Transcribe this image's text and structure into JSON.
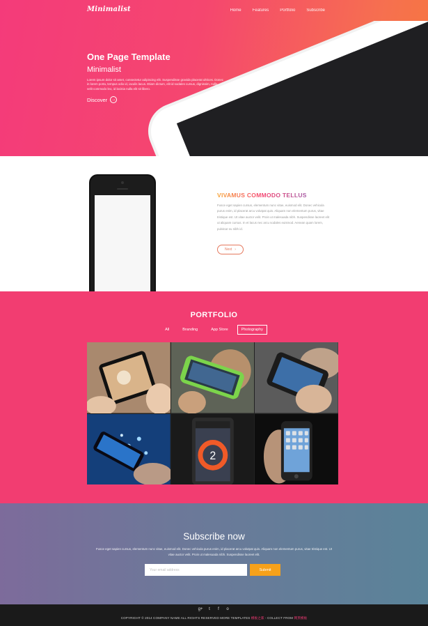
{
  "header": {
    "logo": "Minimalist",
    "nav": [
      "Home",
      "Features",
      "Portfolio",
      "Subscribe"
    ]
  },
  "hero": {
    "title": "One Page Template",
    "subtitle": "Minimalist",
    "body": "Lorem ipsum dolor sit amet, consectetur adipiscing elit. Suspendisse gravida placerat ultrices. Donec in lorem porta, tempus odio id, iaculis lacus. Etiam dictum, elit id sodales cursus, dignissim, nulla velit commodo leo, id lacinia nulla elit sit libero.",
    "cta": "Discover",
    "cta_icon": "arrow-right-icon"
  },
  "feature": {
    "title": "VIVAMUS COMMODO TELLUS",
    "body": "Fusce eget sapien cursus, elementum nunc vitae, euismod elit. Donec vehicula purus enim, id placerat arcu volutpat quis. Aliquam non elementum purus, vitae tristique est. Ut vitae auctor velit. Proin ut malesuada nibh. Suspendisse laoreet elit ut aliquam cursus. In et lacus nec arcu sodales euismod. Aenean quam lorem, pulvinar eu nibh id.",
    "button": "Next",
    "button_icon": "chevron-right-icon"
  },
  "portfolio": {
    "title": "PORTFOLIO",
    "filters": [
      "All",
      "Branding",
      "App Store",
      "Photography"
    ],
    "active_filter": "Photography",
    "tiles": [
      "phone-photo-1",
      "phone-photo-2",
      "phone-photo-3",
      "phone-photo-4",
      "phone-photo-5",
      "phone-photo-6"
    ]
  },
  "subscribe": {
    "title": "Subscribe now",
    "body": "Fusce eget sapien cursus, elementum nunc vitae, euismod elit. Donec vehicula purus enim, id placerat arcu volutpat quis. Aliquam non elementum purus, vitae tristique est. Ut vitae auctor velit. Proin ut malesuada nibh. Suspendisse laoreet elit.",
    "email_placeholder": "Your email address",
    "submit": "Submit"
  },
  "footer": {
    "socials": [
      "g+",
      "t",
      "f",
      "o"
    ],
    "copyright_prefix": "COPYRIGHT © 2014 COMPANY NAME ALL RIGHTS RESERVED MORE TEMPLATES ",
    "copyright_link1": "模板之家",
    "copyright_mid": " - COLLECT FROM ",
    "copyright_link2": "网页模板"
  },
  "colors": {
    "hero_start": "#f43b7a",
    "hero_end": "#f7773f",
    "portfolio_bg": "#f23d71",
    "subscribe_start": "#7d6b9b",
    "subscribe_end": "#5a8399",
    "submit_bg": "#f6a11a",
    "footer_bg": "#1a1a1a"
  }
}
